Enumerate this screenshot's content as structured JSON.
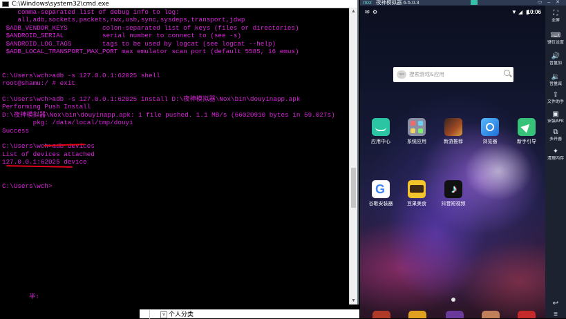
{
  "cmd": {
    "title": "C:\\Windows\\system32\\cmd.exe",
    "lines": [
      "    comma-separated list of debug info to log:",
      "    all,adb,sockets,packets,rwx,usb,sync,sysdeps,transport,jdwp",
      " $ADB_VENDOR_KEYS         colon-separated list of keys (files or directories)",
      " $ANDROID_SERIAL          serial number to connect to (see -s)",
      " $ANDROID_LOG_TAGS        tags to be used by logcat (see logcat --help)",
      " $ADB_LOCAL_TRANSPORT_MAX_PORT max emulator scan port (default 5585, 16 emus)",
      "",
      "",
      "C:\\Users\\wch>adb -s 127.0.0.1:62025 shell",
      "root@shamu:/ # exit",
      "",
      "C:\\Users\\wch>adb -s 127.0.0.1:62025 install D:\\夜神模拟器\\Nox\\bin\\douyinapp.apk",
      "Performing Push Install",
      "D:\\夜神模拟器\\Nox\\bin\\douyinapp.apk: 1 file pushed. 1.1 MB/s (66020910 bytes in 59.027s)",
      "        pkg: /data/local/tmp/douyi",
      "Success",
      "",
      "C:\\Users\\wch>adb devices",
      "List of devices attached",
      "127.0.0.1:62025 device",
      "",
      "",
      "C:\\Users\\wch>"
    ],
    "input_line": "       半:"
  },
  "explorer": {
    "folder_toggle": "v",
    "folder_label": "个人分类"
  },
  "nox": {
    "logo": "nox",
    "title": "夜神模拟器 6.5.0.3",
    "window_buttons": "▭ – ✕",
    "status": {
      "time": "10:06",
      "icons": [
        "✉",
        "⚙",
        "▼",
        "◢",
        "▮"
      ]
    },
    "search": {
      "logo_text": "nox",
      "placeholder": "搜索游戏&应用"
    },
    "apps_row1": [
      {
        "label": "应用中心",
        "icon": "app-center-icon",
        "color": "#2cc5a4"
      },
      {
        "label": "系统应用",
        "icon": "system-apps-icon",
        "color": "#8a8fa3"
      },
      {
        "label": "新游推荐",
        "icon": "new-games-icon",
        "color": "#7a3020"
      },
      {
        "label": "浏览器",
        "icon": "browser-icon",
        "color": "#2b8fe3"
      },
      {
        "label": "新手引导",
        "icon": "guide-icon",
        "color": "#37c27a"
      }
    ],
    "apps_row2": [
      {
        "label": "谷歌安装器",
        "icon": "google-installer-icon",
        "color": "#ffffff"
      },
      {
        "label": "豆果美食",
        "icon": "douguo-icon",
        "color": "#f4c52a"
      },
      {
        "label": "抖音短视频",
        "icon": "douyin-icon",
        "color": "#111111"
      }
    ],
    "sidebar": [
      {
        "label": "全屏",
        "icon": "fullscreen-icon",
        "glyph": "⛶"
      },
      {
        "label": "键位设置",
        "icon": "keyboard-icon",
        "glyph": "⌨"
      },
      {
        "label": "音量加",
        "icon": "volume-up-icon",
        "glyph": "🔊"
      },
      {
        "label": "音量减",
        "icon": "volume-down-icon",
        "glyph": "🔉"
      },
      {
        "label": "文件助手",
        "icon": "file-assistant-icon",
        "glyph": "⇪"
      },
      {
        "label": "安装APK",
        "icon": "install-apk-icon",
        "glyph": "▣"
      },
      {
        "label": "多开器",
        "icon": "multi-instance-icon",
        "glyph": "⧉"
      },
      {
        "label": "清理内存",
        "icon": "clean-memory-icon",
        "glyph": "✦"
      }
    ],
    "nav": {
      "back": "↩",
      "menu": "≡"
    }
  },
  "colors": {
    "terminal_text": "#dc24dc",
    "annotation_red": "#e2001a",
    "nox_sidebar": "#1c2230"
  }
}
